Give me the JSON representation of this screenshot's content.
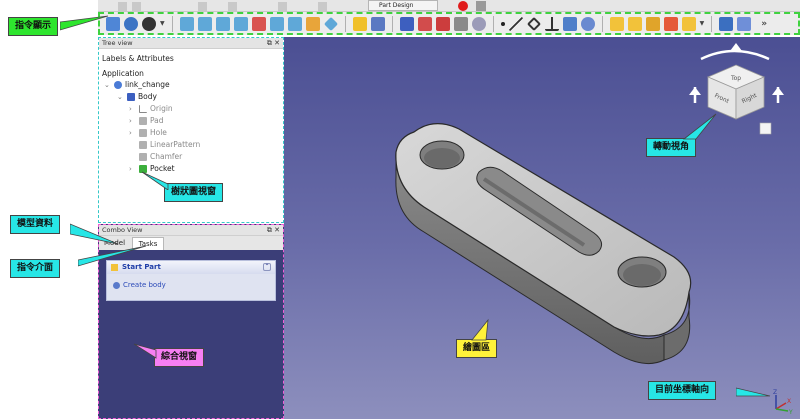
{
  "toolbar": {
    "workbench": "Part Design"
  },
  "tree_view": {
    "title": "Tree view",
    "labels_header": "Labels & Attributes",
    "application": "Application",
    "items": [
      {
        "label": "link_change",
        "icon_color": "#4a7bd6"
      },
      {
        "label": "Body",
        "icon_color": "#3c5fc0"
      },
      {
        "label": "Origin",
        "icon_color": "#9a9a9a"
      },
      {
        "label": "Pad",
        "icon_color": "#b0b0b0"
      },
      {
        "label": "Hole",
        "icon_color": "#b0b0b0"
      },
      {
        "label": "LinearPattern",
        "icon_color": "#b0b0b0"
      },
      {
        "label": "Chamfer",
        "icon_color": "#b0b0b0"
      },
      {
        "label": "Pocket",
        "icon_color": "#3caf3c"
      }
    ]
  },
  "combo_view": {
    "title": "Combo View",
    "tab_model": "Model",
    "tab_tasks": "Tasks",
    "task_header": "Start Part",
    "task_item": "Create body"
  },
  "nav_cube": {
    "face_top": "Top",
    "face_front": "Front",
    "face_right": "Right"
  },
  "axis": {
    "x": "X",
    "y": "Y",
    "z": "Z"
  },
  "callouts": {
    "command_display": "指令顯示",
    "tree_window": "樹狀圖視窗",
    "model_data": "模型資料",
    "command_interface": "指令介面",
    "combo_window": "綜合視窗",
    "rotate_view": "轉動視角",
    "drawing_area": "繪圖區",
    "current_axes": "目前坐標軸向"
  },
  "colors": {
    "toolbar_highlight": "#3fd23f",
    "tree_highlight": "#35c8c8",
    "combo_highlight": "#ef5fd6",
    "view_bg_top": "#4b4f93",
    "view_bg_bottom": "#8d8fbd"
  }
}
